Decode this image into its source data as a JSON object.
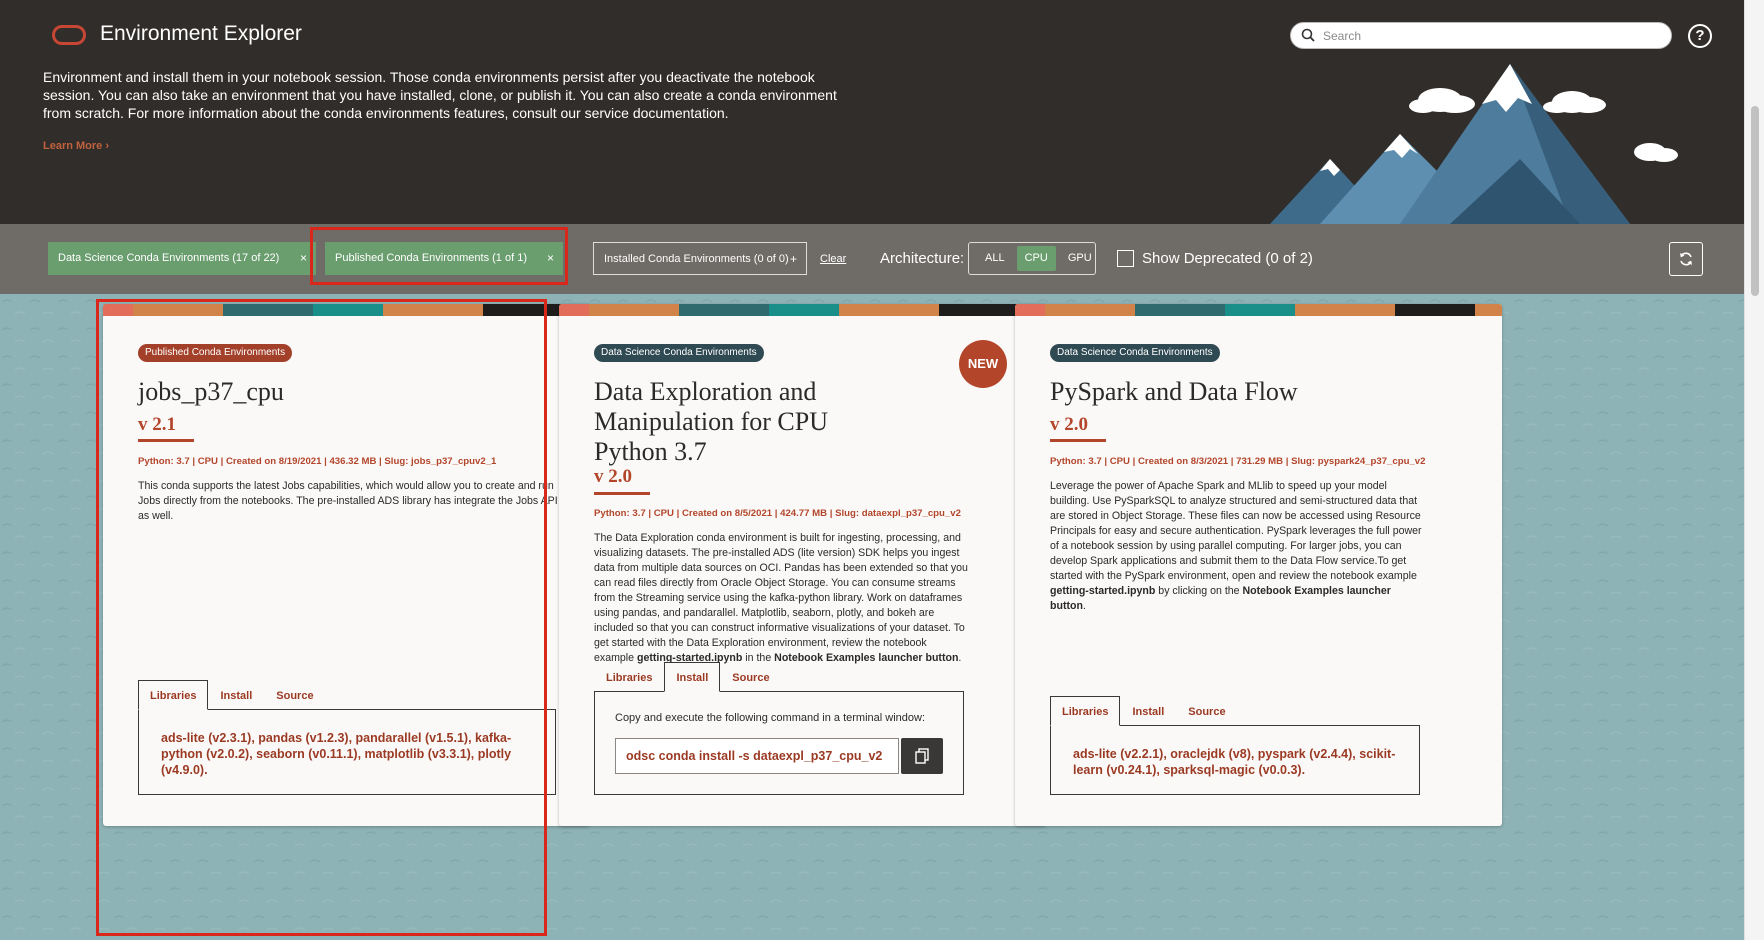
{
  "header": {
    "title": "Environment Explorer",
    "search_placeholder": "Search",
    "help_glyph": "?",
    "intro": "Environment and install them in your notebook session. Those conda environments persist after you deactivate the notebook session. You can also take an environment that you have installed, clone, or publish it. You can also create a conda environment from scratch. For more information about the conda environments features, consult our service documentation.",
    "learn_more": "Learn More",
    "colors": {
      "background": "#312d2a",
      "brand": "#c74634"
    }
  },
  "filters": {
    "chips": [
      {
        "label": "Data Science Conda Environments (17 of 22)",
        "action": "×",
        "active": true
      },
      {
        "label": "Published Conda Environments (1 of 1)",
        "action": "×",
        "active": true
      },
      {
        "label": "Installed Conda Environments (0 of 0)",
        "action": "+",
        "active": false
      }
    ],
    "clear": "Clear",
    "architecture_label": "Architecture:",
    "architecture_options": [
      "ALL",
      "CPU",
      "GPU"
    ],
    "architecture_selected": "CPU",
    "show_deprecated": "Show Deprecated (0 of 2)",
    "show_deprecated_checked": false,
    "refresh_icon": "refresh-icon",
    "colors": {
      "bar": "#6f6b66",
      "active_chip": "#6b9e6f"
    }
  },
  "cards": [
    {
      "badge": "Published Conda Environments",
      "title": "jobs_p37_cpu",
      "version": "v 2.1",
      "meta": "Python: 3.7 | CPU | Created on 8/19/2021 | 436.32 MB | Slug: jobs_p37_cpuv2_1",
      "description": "This conda supports the latest Jobs capabilities, which would allow you to create and run Jobs directly from the notebooks. The pre-installed ADS library has integrate the Jobs API as well.",
      "tabs": [
        "Libraries",
        "Install",
        "Source"
      ],
      "selected_tab": "Libraries",
      "libraries": "ads-lite (v2.3.1), pandas (v1.2.3), pandarallel (v1.5.1), kafka-python (v2.0.2), seaborn (v0.11.1), matplotlib (v3.3.1), plotly (v4.9.0)."
    },
    {
      "badge": "Data Science Conda Environments",
      "new_badge": "NEW",
      "title": "Data Exploration and Manipulation for CPU Python 3.7",
      "version": "v 2.0",
      "meta": "Python: 3.7 | CPU | Created on 8/5/2021 | 424.77 MB | Slug: dataexpl_p37_cpu_v2",
      "description_pre": "The Data Exploration conda environment is built for ingesting, processing, and visualizing datasets. The pre-installed ADS (lite version) SDK helps you ingest data from multiple data sources on OCI. Pandas has been extended so that you can read files directly from Oracle Object Storage. You can consume streams from the Streaming service using the kafka-python library. Work on dataframes using pandas, and pandarallel. Matplotlib, seaborn, plotly, and bokeh are included so that you can construct informative visualizations of your dataset. To get started with the Data Exploration environment, review the notebook example ",
      "description_bold1": "getting-started.ipynb",
      "description_mid": " in the ",
      "description_bold2": "Notebook Examples launcher button",
      "description_post": ".",
      "tabs": [
        "Libraries",
        "Install",
        "Source"
      ],
      "selected_tab": "Install",
      "install_instruction": "Copy and execute the following command in a terminal window:",
      "install_command": "odsc conda install -s dataexpl_p37_cpu_v2",
      "copy_icon": "copy-icon"
    },
    {
      "badge": "Data Science Conda Environments",
      "title": "PySpark and Data Flow",
      "version": "v 2.0",
      "meta": "Python: 3.7 | CPU | Created on 8/3/2021 | 731.29 MB | Slug: pyspark24_p37_cpu_v2",
      "description_pre": "Leverage the power of Apache Spark and MLlib to speed up your model building. Use PySparkSQL to analyze structured and semi-structured data that are stored in Object Storage. These files can now be accessed using Resource Principals for easy and secure authentication. PySpark leverages the full power of a notebook session by using parallel computing. For larger jobs, you can develop Spark applications and submit them to the Data Flow service.To get started with the PySpark environment, open and review the notebook example ",
      "description_bold1": "getting-started.ipynb",
      "description_mid": " by clicking on the ",
      "description_bold2": "Notebook Examples launcher button",
      "description_post": ".",
      "tabs": [
        "Libraries",
        "Install",
        "Source"
      ],
      "selected_tab": "Libraries",
      "libraries": "ads-lite (v2.2.1), oraclejdk (v8), pyspark (v2.4.4), scikit-learn (v0.24.1), sparksql-magic (v0.0.3)."
    }
  ]
}
